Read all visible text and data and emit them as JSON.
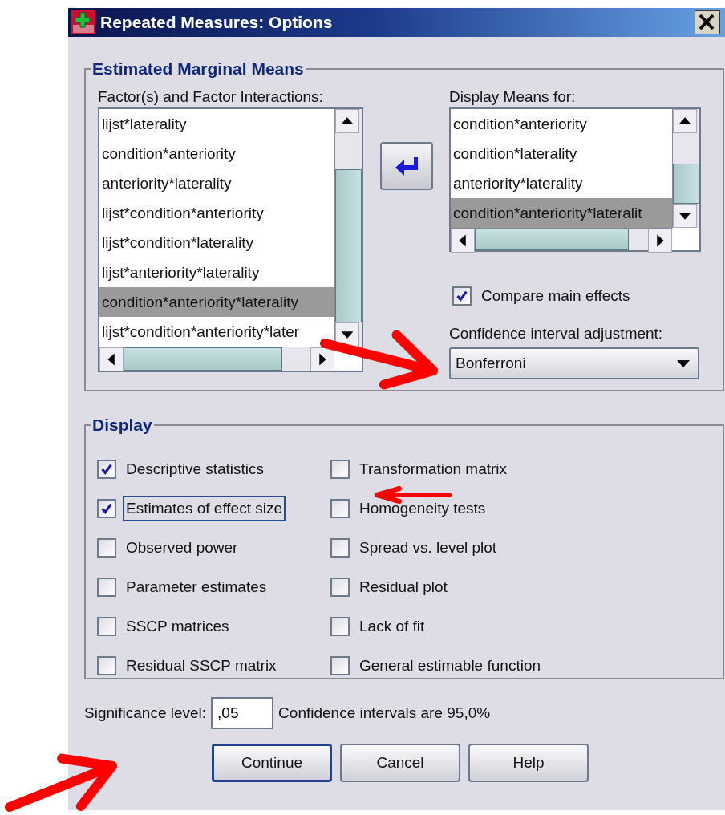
{
  "window": {
    "title": "Repeated Measures: Options"
  },
  "estimated_marginal_means": {
    "title": "Estimated Marginal Means",
    "factors_label": "Factor(s) and Factor Interactions:",
    "factors": [
      {
        "label": "lijst*laterality",
        "selected": false
      },
      {
        "label": "condition*anteriority",
        "selected": false
      },
      {
        "label": "anteriority*laterality",
        "selected": false
      },
      {
        "label": "lijst*condition*anteriority",
        "selected": false
      },
      {
        "label": "lijst*condition*laterality",
        "selected": false
      },
      {
        "label": "lijst*anteriority*laterality",
        "selected": false
      },
      {
        "label": "condition*anteriority*laterality",
        "selected": true
      },
      {
        "label": "lijst*condition*anteriority*later",
        "selected": false
      }
    ],
    "display_means_label": "Display Means for:",
    "display_means": [
      {
        "label": "condition*anteriority",
        "selected": false
      },
      {
        "label": "condition*laterality",
        "selected": false
      },
      {
        "label": "anteriority*laterality",
        "selected": false
      },
      {
        "label": "condition*anteriority*lateralit",
        "selected": true
      }
    ],
    "compare_main_effects": {
      "label": "Compare main effects",
      "checked": true
    },
    "ci_adjustment_label": "Confidence interval adjustment:",
    "ci_adjustment": "Bonferroni"
  },
  "display": {
    "title": "Display",
    "options": [
      {
        "label": "Descriptive statistics",
        "checked": true,
        "focused": false
      },
      {
        "label": "Estimates of effect size",
        "checked": true,
        "focused": true
      },
      {
        "label": "Observed power",
        "checked": false,
        "focused": false
      },
      {
        "label": "Parameter estimates",
        "checked": false,
        "focused": false
      },
      {
        "label": "SSCP matrices",
        "checked": false,
        "focused": false
      },
      {
        "label": "Residual SSCP matrix",
        "checked": false,
        "focused": false
      },
      {
        "label": "Transformation matrix",
        "checked": false,
        "focused": false
      },
      {
        "label": "Homogeneity tests",
        "checked": false,
        "focused": false
      },
      {
        "label": "Spread vs. level plot",
        "checked": false,
        "focused": false
      },
      {
        "label": "Residual plot",
        "checked": false,
        "focused": false
      },
      {
        "label": "Lack of fit",
        "checked": false,
        "focused": false
      },
      {
        "label": "General estimable function",
        "checked": false,
        "focused": false
      }
    ]
  },
  "significance_level": {
    "label": "Significance level:",
    "value": ",05",
    "note": "Confidence intervals are 95,0%"
  },
  "buttons": [
    {
      "label": "Continue",
      "default": true
    },
    {
      "label": "Cancel",
      "default": false
    },
    {
      "label": "Help",
      "default": false
    }
  ],
  "annotations": [
    {
      "kind": "arrow"
    },
    {
      "kind": "arrow"
    },
    {
      "kind": "arrow"
    }
  ]
}
